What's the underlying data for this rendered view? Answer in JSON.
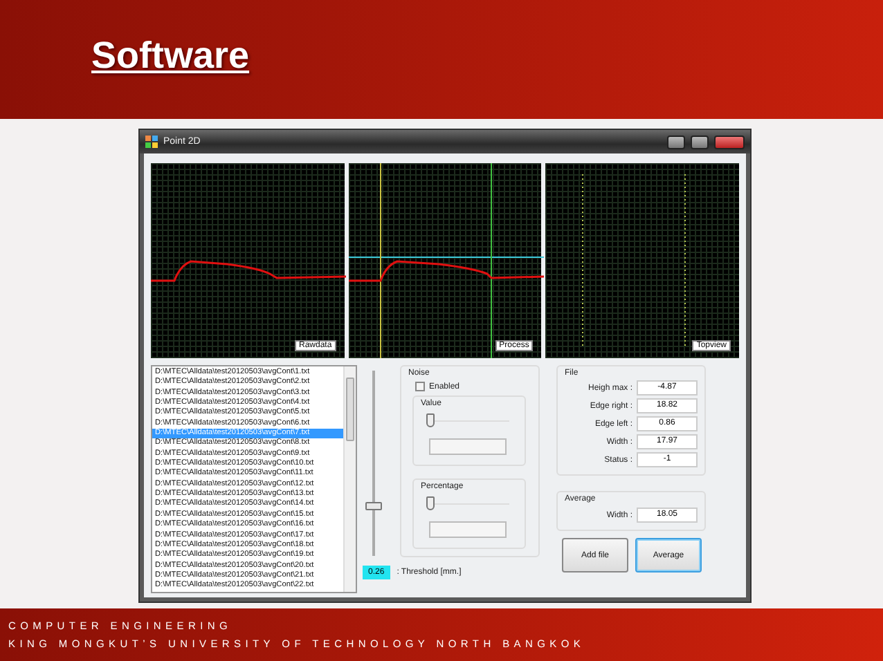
{
  "slide": {
    "title": "Software",
    "footer": [
      "COMPUTER ENGINEERING",
      "KING MONGKUT’S UNIVERSITY OF TECHNOLOGY NORTH BANGKOK"
    ]
  },
  "window": {
    "title": "Point 2D"
  },
  "plots": [
    {
      "label": "Rawdata",
      "kind": "profile"
    },
    {
      "label": "Process",
      "kind": "process"
    },
    {
      "label": "Topview",
      "kind": "topview"
    }
  ],
  "file_list": {
    "items": [
      {
        "path": "D:\\MTEC\\Alldata\\test20120503\\avgCont\\1.txt",
        "selected": false
      },
      {
        "path": "D:\\MTEC\\Alldata\\test20120503\\avgCont\\2.txt",
        "selected": false
      },
      {
        "path": "D:\\MTEC\\Alldata\\test20120503\\avgCont\\3.txt",
        "selected": false
      },
      {
        "path": "D:\\MTEC\\Alldata\\test20120503\\avgCont\\4.txt",
        "selected": false
      },
      {
        "path": "D:\\MTEC\\Alldata\\test20120503\\avgCont\\5.txt",
        "selected": false
      },
      {
        "path": "D:\\MTEC\\Alldata\\test20120503\\avgCont\\6.txt",
        "selected": false
      },
      {
        "path": "D:\\MTEC\\Alldata\\test20120503\\avgCont\\7.txt",
        "selected": true
      },
      {
        "path": "D:\\MTEC\\Alldata\\test20120503\\avgCont\\8.txt",
        "selected": false
      },
      {
        "path": "D:\\MTEC\\Alldata\\test20120503\\avgCont\\9.txt",
        "selected": false
      },
      {
        "path": "D:\\MTEC\\Alldata\\test20120503\\avgCont\\10.txt",
        "selected": false
      },
      {
        "path": "D:\\MTEC\\Alldata\\test20120503\\avgCont\\11.txt",
        "selected": false
      },
      {
        "path": "D:\\MTEC\\Alldata\\test20120503\\avgCont\\12.txt",
        "selected": false
      },
      {
        "path": "D:\\MTEC\\Alldata\\test20120503\\avgCont\\13.txt",
        "selected": false
      },
      {
        "path": "D:\\MTEC\\Alldata\\test20120503\\avgCont\\14.txt",
        "selected": false
      },
      {
        "path": "D:\\MTEC\\Alldata\\test20120503\\avgCont\\15.txt",
        "selected": false
      },
      {
        "path": "D:\\MTEC\\Alldata\\test20120503\\avgCont\\16.txt",
        "selected": false
      },
      {
        "path": "D:\\MTEC\\Alldata\\test20120503\\avgCont\\17.txt",
        "selected": false
      },
      {
        "path": "D:\\MTEC\\Alldata\\test20120503\\avgCont\\18.txt",
        "selected": false
      },
      {
        "path": "D:\\MTEC\\Alldata\\test20120503\\avgCont\\19.txt",
        "selected": false
      },
      {
        "path": "D:\\MTEC\\Alldata\\test20120503\\avgCont\\20.txt",
        "selected": false
      },
      {
        "path": "D:\\MTEC\\Alldata\\test20120503\\avgCont\\21.txt",
        "selected": false
      },
      {
        "path": "D:\\MTEC\\Alldata\\test20120503\\avgCont\\22.txt",
        "selected": false
      }
    ]
  },
  "threshold": {
    "level": 0.26,
    "value": "0.26",
    "label": ": Threshold [mm.]"
  },
  "noise": {
    "title": "Noise",
    "enabled": {
      "label": "Enabled",
      "checked": false
    },
    "sliders": [
      {
        "title": "Value",
        "level": 0
      },
      {
        "title": "Percentage",
        "level": 0
      }
    ]
  },
  "file": {
    "title": "File",
    "fields": [
      {
        "label": "Heigh max :",
        "value": "-4.87"
      },
      {
        "label": "Edge right :",
        "value": "18.82"
      },
      {
        "label": "Edge left :",
        "value": "0.86"
      },
      {
        "label": "Width :",
        "value": "17.97"
      },
      {
        "label": "Status :",
        "value": "-1"
      }
    ]
  },
  "average": {
    "title": "Average",
    "fields": [
      {
        "label": "Width :",
        "value": "18.05"
      }
    ]
  },
  "buttons": [
    {
      "label": "Add file",
      "focused": false
    },
    {
      "label": "Average",
      "focused": true
    }
  ]
}
